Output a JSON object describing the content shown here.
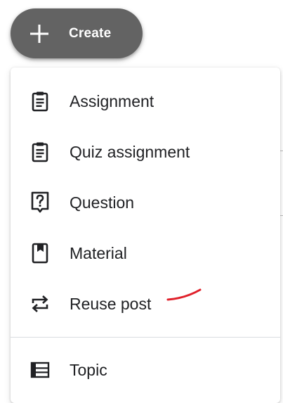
{
  "create_button": {
    "label": "Create",
    "icon": "plus-icon"
  },
  "menu": {
    "items": [
      {
        "label": "Assignment",
        "icon": "assignment-icon"
      },
      {
        "label": "Quiz assignment",
        "icon": "quiz-assignment-icon"
      },
      {
        "label": "Question",
        "icon": "question-icon"
      },
      {
        "label": "Material",
        "icon": "material-icon"
      },
      {
        "label": "Reuse post",
        "icon": "reuse-post-icon"
      },
      {
        "label": "Topic",
        "icon": "topic-icon"
      }
    ]
  },
  "colors": {
    "create_button_bg": "#636363",
    "text": "#202124",
    "icon": "#202124",
    "annotation": "#e0202a"
  }
}
